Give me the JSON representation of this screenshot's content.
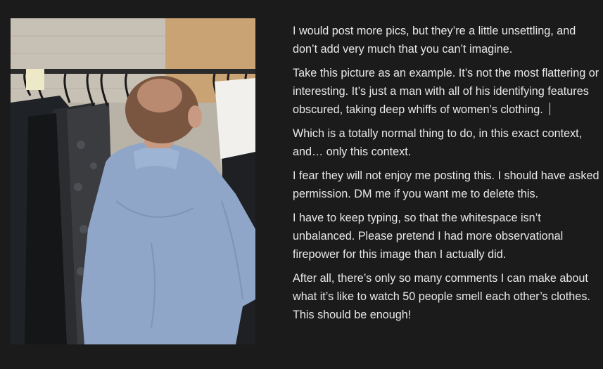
{
  "post": {
    "photo_alt": "Man in a light blue shirt with his face buried in clothing on a rack",
    "paragraphs": [
      "I would post more pics, but they’re a little unsettling, and don’t add very much that you can’t imagine.",
      "Take this picture as an example. It’s not the most flattering or interesting. It’s just a man with all of his identifying features obscured, taking deep whiffs of women’s clothing.",
      "Which is a totally normal thing to do, in this exact context, and… only this context.",
      "I fear they will not enjoy me posting this. I should have asked permission. DM me if you want me to delete this.",
      "I have to keep typing, so that the whitespace isn’t unbalanced.  Please pretend I had more observational firepower for this image than I actually did.",
      "After all, there’s only so many comments I can make about what it’s like to watch 50 people smell each other’s clothes. This should be enough!"
    ]
  },
  "colors": {
    "background": "#1b1b1b",
    "text": "#e8e8e8",
    "shirt": "#8fa6c8"
  }
}
